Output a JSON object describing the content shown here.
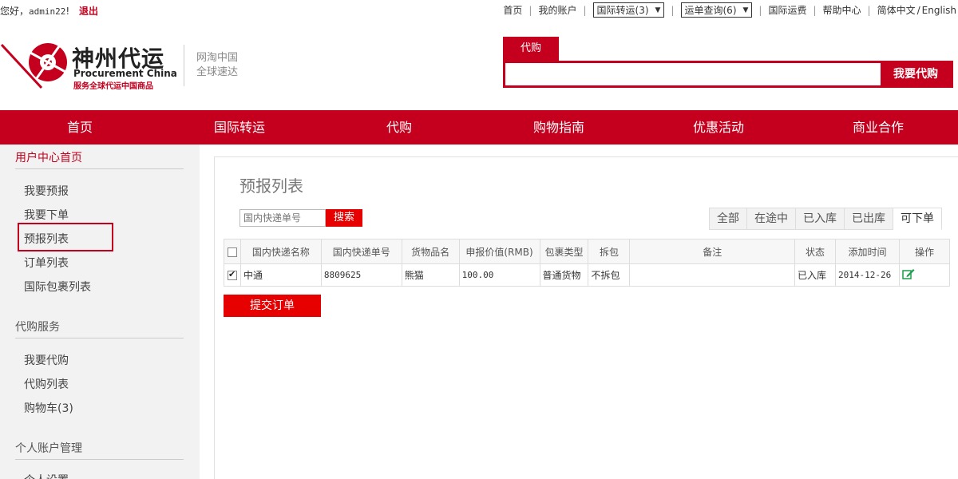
{
  "topbar": {
    "greeting": "您好，",
    "username": "admin22",
    "exclaim": "!",
    "logout": "退出",
    "links": {
      "home": "首页",
      "account": "我的账户",
      "transfer": "国际转运(3)",
      "waybill": "运单查询(6)",
      "freight": "国际运费",
      "help": "帮助中心",
      "lang_cn": "简体中文",
      "lang_en": "English"
    }
  },
  "header": {
    "brand_cn": "神州代运",
    "brand_en": "Procurement China",
    "brand_sub": "服务全球代运中国商品",
    "slogan_1": "网淘中国",
    "slogan_2": "全球速达",
    "search_tab": "代购",
    "search_value": "",
    "search_button": "我要代购"
  },
  "nav": {
    "items": [
      "首页",
      "国际转运",
      "代购",
      "购物指南",
      "优惠活动",
      "商业合作"
    ]
  },
  "sidebar": {
    "section1": "用户中心首页",
    "items1": [
      "我要预报",
      "我要下单",
      "预报列表",
      "订单列表",
      "国际包裹列表"
    ],
    "section2": "代购服务",
    "items2": [
      "我要代购",
      "代购列表",
      "购物车(3)"
    ],
    "section3": "个人账户管理",
    "items3": [
      "个人设置"
    ]
  },
  "main": {
    "title": "预报列表",
    "filter_placeholder": "国内快递单号",
    "filter_button": "搜索",
    "tabs": [
      "全部",
      "在途中",
      "已入库",
      "已出库",
      "可下单"
    ],
    "columns": [
      "国内快递名称",
      "国内快递单号",
      "货物品名",
      "申报价值(RMB)",
      "包裹类型",
      "拆包",
      "备注",
      "状态",
      "添加时间",
      "操作"
    ],
    "rows": [
      {
        "courier": "中通",
        "tracking": "8809625",
        "goods": "熊猫",
        "value": "100.00",
        "type": "普通货物",
        "unpack": "不拆包",
        "note": "",
        "status": "已入库",
        "date": "2014-12-26"
      }
    ],
    "submit_button": "提交订单"
  },
  "colors": {
    "brand": "#c4001e",
    "button": "#e60000",
    "edit_icon": "#1a9e4a"
  },
  "icons": {
    "edit": "edit-icon",
    "dropdown": "triangle-down-icon",
    "logo": "logo-mark-icon"
  }
}
